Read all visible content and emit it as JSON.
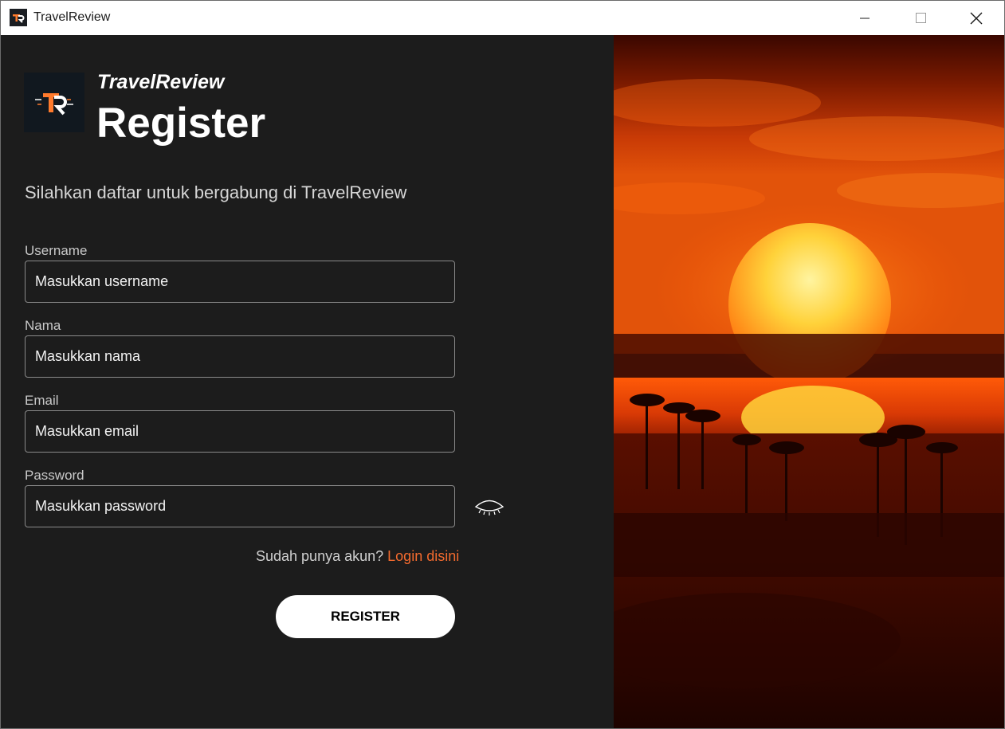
{
  "window": {
    "title": "TravelReview"
  },
  "header": {
    "brand": "TravelReview",
    "heading": "Register",
    "subtitle": "Silahkan daftar untuk bergabung di TravelReview"
  },
  "form": {
    "username": {
      "label": "Username",
      "placeholder": "Masukkan username",
      "value": ""
    },
    "nama": {
      "label": "Nama",
      "placeholder": "Masukkan nama",
      "value": ""
    },
    "email": {
      "label": "Email",
      "placeholder": "Masukkan email",
      "value": ""
    },
    "password": {
      "label": "Password",
      "placeholder": "Masukkan password",
      "value": ""
    },
    "password_toggle_icon": "eye-closed-icon"
  },
  "login_prompt": {
    "text": "Sudah punya akun?",
    "link": "Login disini"
  },
  "register_button": "REGISTER",
  "colors": {
    "panel": "#1c1c1c",
    "link": "#f26a2e",
    "button": "#ffffff"
  }
}
